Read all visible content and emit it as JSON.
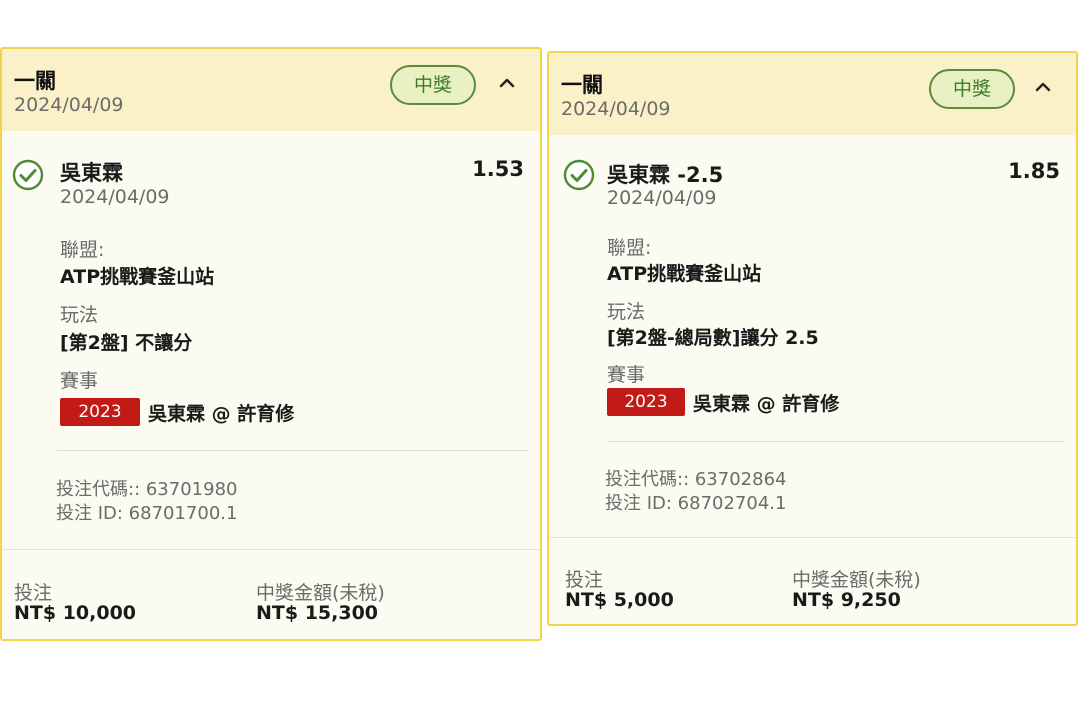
{
  "colors": {
    "card_border": "#f3d34a",
    "header_bg": "#fbf1c9",
    "card_bg": "#fcfbf1",
    "win_badge_border": "#5b8c39",
    "win_badge_bg": "#e9f0c2",
    "win_badge_text": "#3e7a2a",
    "year_badge_bg": "#c21b17"
  },
  "icons": {
    "status": "check-circle-icon",
    "toggle": "chevron-up-icon"
  },
  "bets": [
    {
      "header": {
        "title": "一關",
        "date": "2024/04/09",
        "status_badge": "中獎"
      },
      "selection": {
        "name": "吳東霖",
        "odds": "1.53",
        "date": "2024/04/09"
      },
      "league": {
        "label": "聯盟:",
        "value": "ATP挑戰賽釜山站"
      },
      "play_type": {
        "label": "玩法",
        "value": "[第2盤] 不讓分"
      },
      "event": {
        "label": "賽事",
        "year": "2023",
        "match": "吳東霖 @ 許育修"
      },
      "codes": {
        "bet_code": "投注代碼:: 63701980",
        "bet_id": "投注 ID: 68701700.1"
      },
      "footer": {
        "stake_label": "投注",
        "stake_value": "NT$ 10,000",
        "winnings_label": "中獎金額(未稅)",
        "winnings_value": "NT$ 15,300"
      }
    },
    {
      "header": {
        "title": "一關",
        "date": "2024/04/09",
        "status_badge": "中獎"
      },
      "selection": {
        "name": "吳東霖 -2.5",
        "odds": "1.85",
        "date": "2024/04/09"
      },
      "league": {
        "label": "聯盟:",
        "value": "ATP挑戰賽釜山站"
      },
      "play_type": {
        "label": "玩法",
        "value": "[第2盤-總局數]讓分 2.5"
      },
      "event": {
        "label": "賽事",
        "year": "2023",
        "match": "吳東霖 @ 許育修"
      },
      "codes": {
        "bet_code": "投注代碼:: 63702864",
        "bet_id": "投注 ID: 68702704.1"
      },
      "footer": {
        "stake_label": "投注",
        "stake_value": "NT$ 5,000",
        "winnings_label": "中獎金額(未稅)",
        "winnings_value": "NT$ 9,250"
      }
    }
  ]
}
